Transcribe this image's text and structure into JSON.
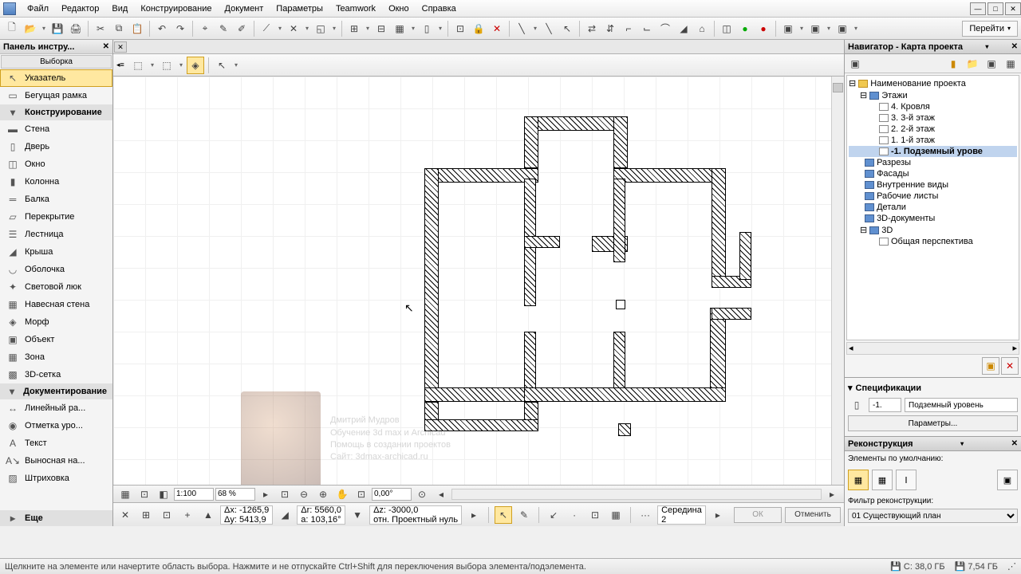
{
  "menu": [
    "Файл",
    "Редактор",
    "Вид",
    "Конструирование",
    "Документ",
    "Параметры",
    "Teamwork",
    "Окно",
    "Справка"
  ],
  "goto": "Перейти",
  "toolpanel": {
    "title": "Панель инстру...",
    "subtitle": "Выборка",
    "pointer": "Указатель",
    "marquee": "Бегущая рамка",
    "section_construct": "Конструирование",
    "items_construct": [
      "Стена",
      "Дверь",
      "Окно",
      "Колонна",
      "Балка",
      "Перекрытие",
      "Лестница",
      "Крыша",
      "Оболочка",
      "Световой люк",
      "Навесная стена",
      "Морф",
      "Объект",
      "Зона",
      "3D-сетка"
    ],
    "section_doc": "Документирование",
    "items_doc": [
      "Линейный ра...",
      "Отметка уро...",
      "Текст",
      "Выносная на...",
      "Штриховка"
    ],
    "more": "Еще"
  },
  "navigator": {
    "title": "Навигатор - Карта проекта",
    "root": "Наименование проекта",
    "stories_label": "Этажи",
    "stories": [
      "4. Кровля",
      "3. 3-й этаж",
      "2. 2-й этаж",
      "1. 1-й этаж",
      "-1. Подземный урове"
    ],
    "sections": [
      "Разрезы",
      "Фасады",
      "Внутренние виды",
      "Рабочие листы",
      "Детали",
      "3D-документы"
    ],
    "3d": "3D",
    "3d_item": "Общая перспектива"
  },
  "spec": {
    "title": "Спецификации",
    "id": "-1.",
    "name": "Подземный уровень",
    "params_btn": "Параметры..."
  },
  "recon": {
    "title": "Реконструкция",
    "default_label": "Элементы по умолчанию:",
    "filter_label": "Фильтр реконструкции:",
    "filter_value": "01 Существующий план"
  },
  "ruler": {
    "scale": "1:100",
    "zoom": "68 %",
    "angle": "0,00°"
  },
  "coords": {
    "dx": "Δx: -1265,9",
    "dy": "Δy: 5413,9",
    "dr": "Δr: 5560,0",
    "da": "a: 103,16°",
    "dz": "Δz: -3000,0",
    "ref": "отн. Проектный нуль",
    "mid": "Середина",
    "mid_n": "2",
    "ok": "ОК",
    "cancel": "Отменить"
  },
  "status": {
    "hint": "Щелкните на элементе или начертите область выбора. Нажмите и не отпускайте Ctrl+Shift для переключения выбора элемента/подэлемента.",
    "disk_c": "C: 38,0 ГБ",
    "disk_d": "7,54 ГБ"
  },
  "overlay": {
    "l1": "Дмитрий Мудров",
    "l2": "Обучение 3d max и Archicad",
    "l3": "Помощь в создании проектов",
    "l4": "Сайт: 3dmax-archicad.ru"
  }
}
